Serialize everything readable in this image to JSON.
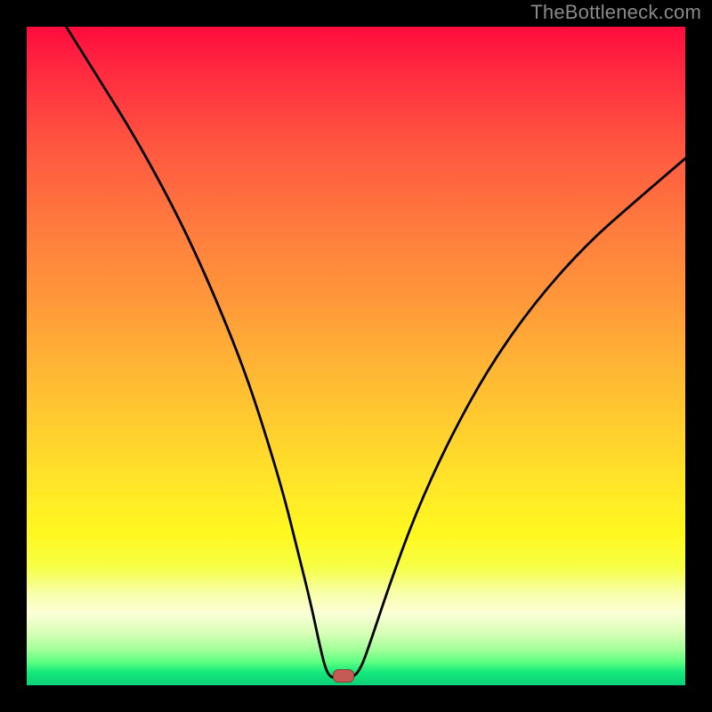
{
  "watermark": {
    "text": "TheBottleneck.com"
  },
  "colors": {
    "frame": "#000000",
    "curve": "#000000",
    "marker_fill": "#c65a54",
    "marker_border": "#8f3a34"
  },
  "chart_data": {
    "type": "line",
    "title": "",
    "xlabel": "",
    "ylabel": "",
    "xlim": [
      0,
      100
    ],
    "ylim": [
      0,
      100
    ],
    "grid": false,
    "legend": false,
    "note": "Axes are unlabeled; x and y given as 0–100 percent of plot width/height with y=0 at bottom.",
    "curve": [
      {
        "x": 6,
        "y": 100
      },
      {
        "x": 11,
        "y": 92
      },
      {
        "x": 16,
        "y": 84
      },
      {
        "x": 21,
        "y": 75
      },
      {
        "x": 25,
        "y": 67
      },
      {
        "x": 29,
        "y": 58
      },
      {
        "x": 33,
        "y": 48
      },
      {
        "x": 36,
        "y": 39
      },
      {
        "x": 39,
        "y": 29
      },
      {
        "x": 41,
        "y": 21
      },
      {
        "x": 43,
        "y": 13
      },
      {
        "x": 44.5,
        "y": 6
      },
      {
        "x": 45.5,
        "y": 2
      },
      {
        "x": 46.5,
        "y": 1
      },
      {
        "x": 49,
        "y": 1
      },
      {
        "x": 50.5,
        "y": 2
      },
      {
        "x": 52,
        "y": 6
      },
      {
        "x": 55,
        "y": 15
      },
      {
        "x": 59,
        "y": 26
      },
      {
        "x": 64,
        "y": 37
      },
      {
        "x": 70,
        "y": 48
      },
      {
        "x": 77,
        "y": 58
      },
      {
        "x": 85,
        "y": 67
      },
      {
        "x": 93,
        "y": 74
      },
      {
        "x": 100,
        "y": 80
      }
    ],
    "marker": {
      "x": 48,
      "y": 1.5
    }
  }
}
